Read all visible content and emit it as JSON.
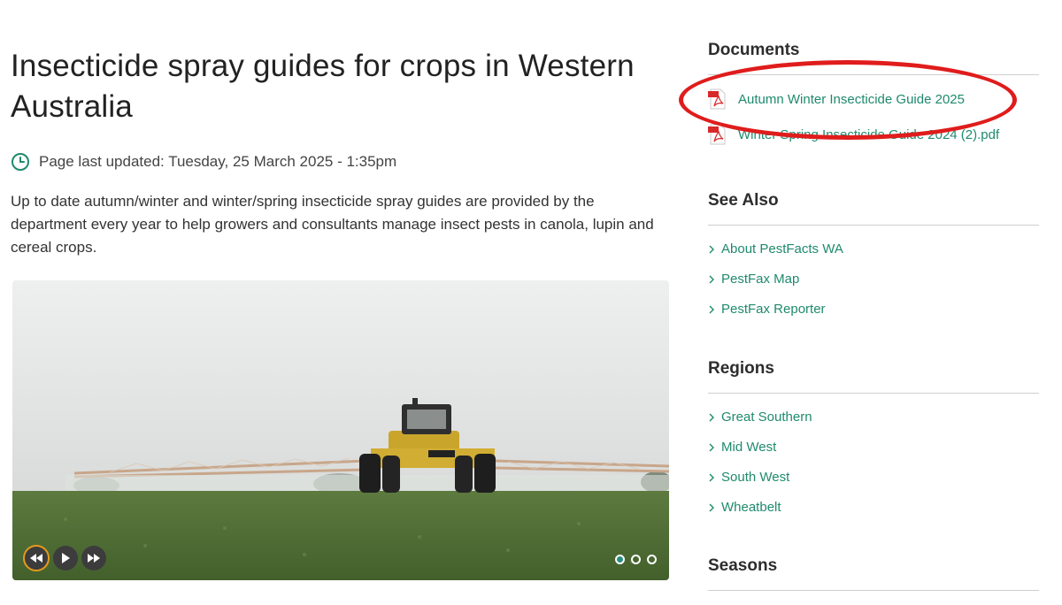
{
  "page": {
    "title": "Insecticide spray guides for crops in Western Australia",
    "last_updated": "Page last updated: Tuesday, 25 March 2025 - 1:35pm",
    "intro": "Up to date autumn/winter and winter/spring insecticide spray guides are provided by the department every year to help growers and consultants manage insect pests in canola, lupin and cereal crops."
  },
  "slideshow": {
    "active_slide": 1,
    "slide_count": 3,
    "controls": {
      "prev_icon": "rewind-icon",
      "play_icon": "play-icon",
      "next_icon": "fast-forward-icon"
    },
    "highlight_color": "#e49a1b"
  },
  "sidebar": {
    "documents": {
      "heading": "Documents",
      "items": [
        {
          "label": "Autumn Winter Insecticide Guide 2025",
          "icon": "pdf-icon"
        },
        {
          "label": "Winter Spring Insecticide Guide 2024 (2).pdf",
          "icon": "pdf-icon"
        }
      ]
    },
    "see_also": {
      "heading": "See Also",
      "items": [
        {
          "label": "About PestFacts WA"
        },
        {
          "label": "PestFax Map"
        },
        {
          "label": "PestFax Reporter"
        }
      ]
    },
    "regions": {
      "heading": "Regions",
      "items": [
        {
          "label": "Great Southern"
        },
        {
          "label": "Mid West"
        },
        {
          "label": "South West"
        },
        {
          "label": "Wheatbelt"
        }
      ]
    },
    "seasons": {
      "heading": "Seasons"
    }
  },
  "colors": {
    "link": "#1f8a6c",
    "annotation_ring": "#e01c1c",
    "accent": "#2a8c7e"
  }
}
